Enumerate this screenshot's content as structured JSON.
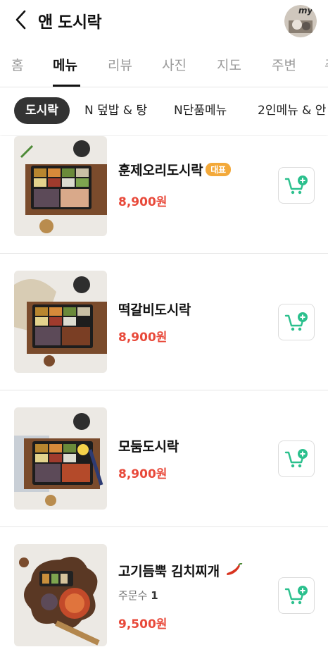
{
  "header": {
    "title": "앤 도시락",
    "avatar_text": "my"
  },
  "tabs": [
    {
      "label": "홈"
    },
    {
      "label": "메뉴"
    },
    {
      "label": "리뷰"
    },
    {
      "label": "사진"
    },
    {
      "label": "지도"
    },
    {
      "label": "주변"
    },
    {
      "label": "주"
    }
  ],
  "categories": [
    {
      "label": "도시락"
    },
    {
      "label": "N 덮밥 & 탕"
    },
    {
      "label": "N단품메뉴"
    },
    {
      "label": "2인메뉴 & 안"
    }
  ],
  "menu": [
    {
      "name": "훈제오리도시락",
      "badge": "대표",
      "price": "8,900원"
    },
    {
      "name": "떡갈비도시락",
      "price": "8,900원"
    },
    {
      "name": "모둠도시락",
      "price": "8,900원"
    },
    {
      "name": "고기듬뿍 김치찌개",
      "orders_label": "주문수",
      "orders_count": "1",
      "price": "9,500원"
    }
  ],
  "colors": {
    "price": "#e8493a",
    "cart_icon": "#2bc08d",
    "badge": "#f3a93a",
    "active_chip": "#333333"
  }
}
